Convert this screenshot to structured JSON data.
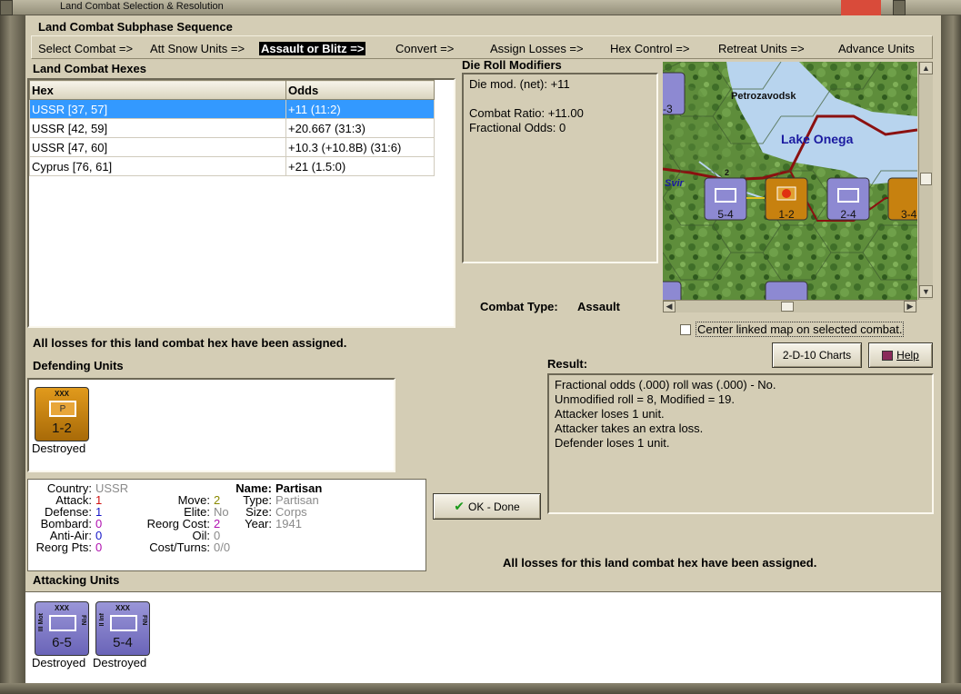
{
  "window": {
    "title": "Land Combat Selection & Resolution"
  },
  "sequence": {
    "title": "Land Combat Subphase Sequence",
    "steps": [
      "Select Combat =>",
      "Att Snow Units =>",
      "Assault or Blitz =>",
      "Convert =>",
      "Assign Losses =>",
      "Hex Control =>",
      "Retreat Units =>",
      "Advance Units"
    ],
    "active_index": 2
  },
  "hexes": {
    "title": "Land Combat Hexes",
    "columns": [
      "Hex",
      "Odds"
    ],
    "rows": [
      {
        "hex": "USSR [37, 57]",
        "odds": "+11 (11:2)"
      },
      {
        "hex": "USSR [42, 59]",
        "odds": "+20.667 (31:3)"
      },
      {
        "hex": "USSR [47, 60]",
        "odds": "+10.3 (+10.8B) (31:6)"
      },
      {
        "hex": "Cyprus [76, 61]",
        "odds": "+21 (1.5:0)"
      }
    ],
    "selected_index": 0
  },
  "die_roll": {
    "title": "Die Roll Modifiers",
    "lines": [
      "Die mod. (net): +11",
      "Combat Ratio: +11.00",
      "Fractional Odds: 0"
    ]
  },
  "map": {
    "city": "Petrozavodsk",
    "lake": "Lake Onega",
    "river": "Svir",
    "counters": [
      {
        "value": "5-4",
        "stack": "2"
      },
      {
        "value": "1-2"
      },
      {
        "value": "2-4"
      },
      {
        "value": "3-4"
      },
      {
        "value": "-3"
      }
    ]
  },
  "combat_type": {
    "label": "Combat Type:",
    "value": "Assault"
  },
  "center_map": {
    "label": "Center linked map on selected combat.",
    "checked": false
  },
  "losses_msg_top": "All losses for this land combat hex have been assigned.",
  "buttons": {
    "charts": "2-D-10 Charts",
    "help": "Help",
    "ok": "OK - Done"
  },
  "defending": {
    "title": "Defending Units",
    "units": [
      {
        "value": "1-2",
        "size": "XXX",
        "letter": "P",
        "status": "Destroyed",
        "color": "#c67f0f"
      }
    ]
  },
  "result": {
    "title": "Result:",
    "lines": [
      "Fractional odds (.000) roll was (.000)  - No.",
      "Unmodified roll = 8, Modified = 19.",
      "Attacker loses 1 unit.",
      "Attacker takes an extra loss.",
      "Defender loses 1 unit."
    ]
  },
  "unit_info": {
    "country": "USSR",
    "attack": "1",
    "defense": "1",
    "bombard": "0",
    "anti_air": "0",
    "reorg_pts": "0",
    "move": "2",
    "elite": "No",
    "reorg_cost": "2",
    "oil": "0",
    "cost_turns": "0/0",
    "name": "Partisan",
    "type": "Partisan",
    "size": "Corps",
    "year": "1941",
    "labels": {
      "country": "Country:",
      "attack": "Attack:",
      "defense": "Defense:",
      "bombard": "Bombard:",
      "anti_air": "Anti-Air:",
      "reorg_pts": "Reorg Pts:",
      "move": "Move:",
      "elite": "Elite:",
      "reorg_cost": "Reorg Cost:",
      "oil": "Oil:",
      "cost_turns": "Cost/Turns:",
      "name": "Name:",
      "type": "Type:",
      "size": "Size:",
      "year": "Year:"
    }
  },
  "losses_msg_bottom": "All losses for this land combat hex have been assigned.",
  "attacking": {
    "title": "Attacking Units",
    "units": [
      {
        "value": "6-5",
        "size": "XXX",
        "side": "III Mot",
        "nation": "FIN",
        "status": "Destroyed",
        "color": "#8782cc"
      },
      {
        "value": "5-4",
        "size": "XXX",
        "side": "II Inf",
        "nation": "FIN",
        "status": "Destroyed",
        "color": "#8782cc"
      }
    ]
  }
}
